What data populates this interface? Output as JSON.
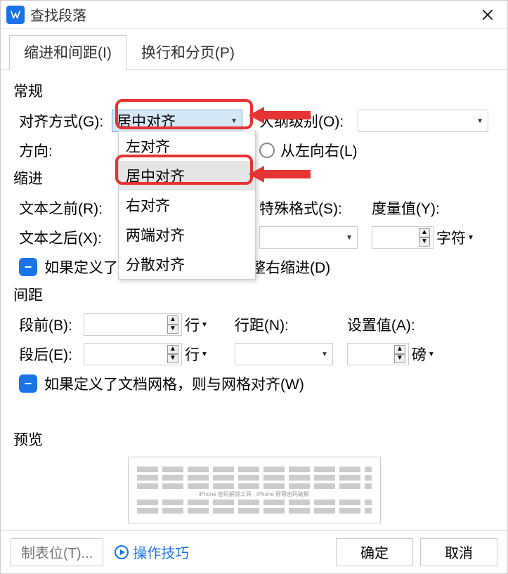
{
  "titlebar": {
    "title": "查找段落"
  },
  "tabs": {
    "indent": "缩进和间距(I)",
    "page": "换行和分页(P)"
  },
  "general": {
    "title": "常规",
    "align_label": "对齐方式(G):",
    "align_value": "居中对齐",
    "outline_label": "大纲级别(O):",
    "outline_value": "",
    "direction_label": "方向:",
    "ltr_label": "从左向右(L)"
  },
  "align_options": {
    "left": "左对齐",
    "center": "居中对齐",
    "right": "右对齐",
    "justify": "两端对齐",
    "scatter": "分散对齐"
  },
  "indent": {
    "title": "缩进",
    "before_label": "文本之前(R):",
    "after_label": "文本之后(X):",
    "special_label": "特殊格式(S):",
    "metric_label": "度量值(Y):",
    "char_unit": "字符",
    "grid_check": "如果定义了文档网格，则自动调整右缩进(D)"
  },
  "spacing": {
    "title": "间距",
    "before_label": "段前(B):",
    "after_label": "段后(E):",
    "line_unit": "行",
    "linespace_label": "行距(N):",
    "setval_label": "设置值(A):",
    "pound_unit": "磅",
    "grid_check": "如果定义了文档网格，则与网格对齐(W)"
  },
  "preview": {
    "title": "预览"
  },
  "footer": {
    "tabs_btn": "制表位(T)...",
    "tips": "操作技巧",
    "ok": "确定",
    "cancel": "取消"
  }
}
